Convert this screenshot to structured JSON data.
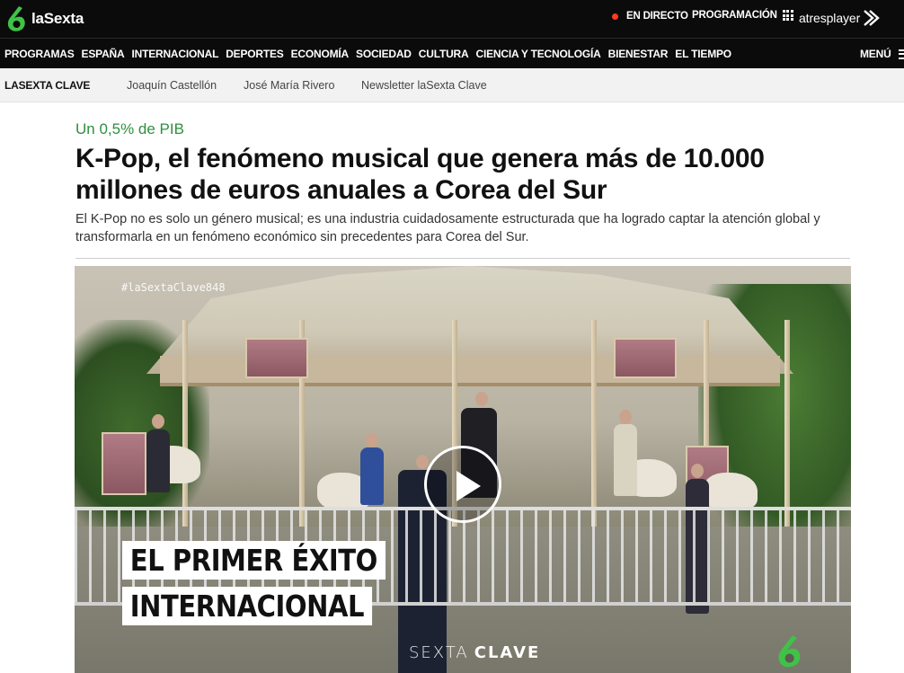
{
  "header": {
    "brand": "laSexta",
    "live_label": "EN DIRECTO",
    "programming_label": "PROGRAMACIÓN",
    "player_label": "atresplayer",
    "colors": {
      "brand_green": "#3fc247",
      "live_red": "#ff3b1f",
      "background": "#0b0b0b"
    }
  },
  "nav": {
    "items": [
      "PROGRAMAS",
      "ESPAÑA",
      "INTERNACIONAL",
      "DEPORTES",
      "ECONOMÍA",
      "SOCIEDAD",
      "CULTURA",
      "CIENCIA Y TECNOLOGÍA",
      "BIENESTAR",
      "EL TIEMPO"
    ],
    "menu_label": "MENÚ"
  },
  "subnav": {
    "title": "LASEXTA CLAVE",
    "links": [
      "Joaquín Castellón",
      "José María Rivero",
      "Newsletter laSexta Clave"
    ]
  },
  "article": {
    "kicker": "Un 0,5% de PIB",
    "headline": "K-Pop, el fenómeno musical que genera más de 10.000 millones de euros anuales a Corea del Sur",
    "subtitle": "El K-Pop no es solo un género musical; es una industria cuidadosamente estructurada que ha logrado captar la atención global y transformarla en un fenómeno económico sin precedentes para Corea del Sur."
  },
  "video": {
    "hashtag": "#laSextaClave848",
    "caption_line1": "EL PRIMER ÉXITO",
    "caption_line2": "INTERNACIONAL",
    "brand_left": "SEXTA",
    "brand_right": "CLAVE",
    "play_icon": "play-icon"
  }
}
